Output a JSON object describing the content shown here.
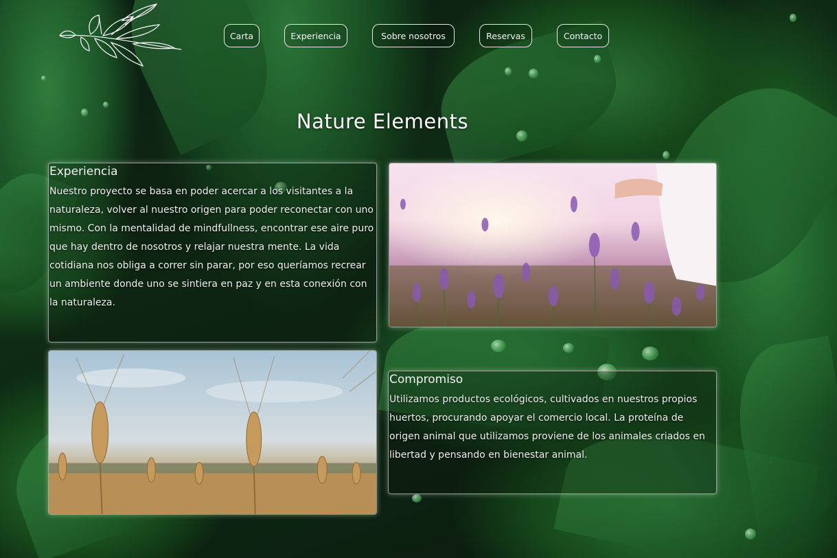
{
  "site": {
    "logo_icon": "olive-branch-icon"
  },
  "nav": {
    "items": [
      {
        "label": "Carta"
      },
      {
        "label": "Experiencia"
      },
      {
        "label": "Sobre nosotros"
      },
      {
        "label": "Reservas"
      },
      {
        "label": "Contacto"
      }
    ]
  },
  "main": {
    "title": "Nature Elements",
    "experiencia": {
      "heading": "Experiencia",
      "text": "Nuestro proyecto se basa en poder acercar a los visitantes a la naturaleza, volver al nuestro origen para poder reconectar con uno mismo. Con la mentalidad de mindfullness, encontrar ese aire puro que hay dentro de nosotros y relajar nuestra mente. La vida cotidiana nos obliga a correr sin parar, por eso queríamos recrear un ambiente donde uno se sintiera en paz y en esta conexión con la naturaleza."
    },
    "compromiso": {
      "heading": "Compromiso",
      "text": "Utilizamos productos ecológicos, cultivados en nuestros propios huertos, procurando apoyar el comercio local. La proteína de origen animal que utilizamos proviene de los animales criados en libertad y pensando en bienestar animal."
    },
    "images": {
      "lavender": "lavender-field-photo",
      "wheat": "wheat-field-photo"
    }
  },
  "colors": {
    "background": "#0d1f12",
    "leaf": "#2f7d3c",
    "text": "#f2f2f2",
    "border": "#e8e8e8"
  }
}
